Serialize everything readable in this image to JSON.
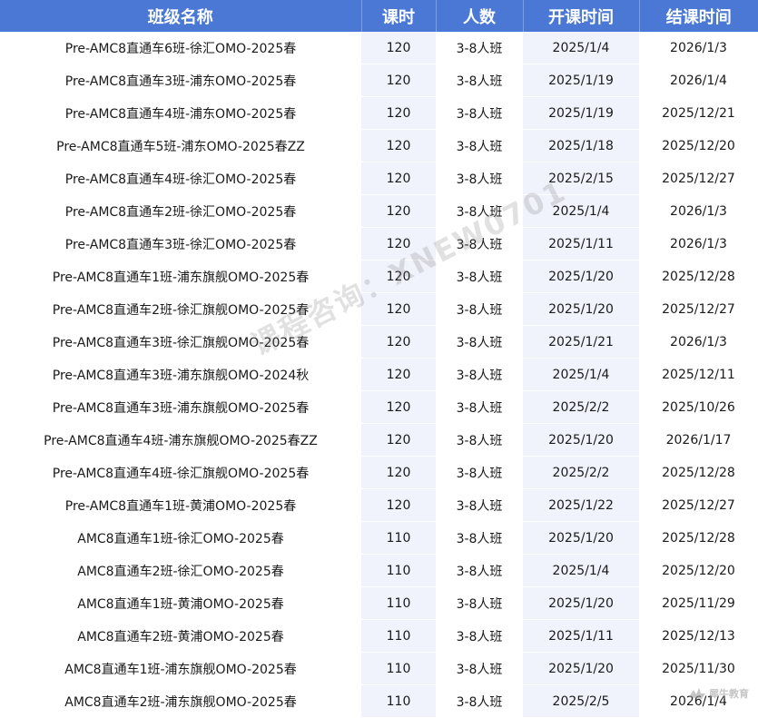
{
  "headers": {
    "name": "班级名称",
    "hours": "课时",
    "size": "人数",
    "start": "开课时间",
    "end": "结课时间"
  },
  "rows": [
    {
      "name": "Pre-AMC8直通车6班-徐汇OMO-2025春",
      "hours": "120",
      "size": "3-8人班",
      "start": "2025/1/4",
      "end": "2026/1/3"
    },
    {
      "name": "Pre-AMC8直通车3班-浦东OMO-2025春",
      "hours": "120",
      "size": "3-8人班",
      "start": "2025/1/19",
      "end": "2026/1/4"
    },
    {
      "name": "Pre-AMC8直通车4班-浦东OMO-2025春",
      "hours": "120",
      "size": "3-8人班",
      "start": "2025/1/19",
      "end": "2025/12/21"
    },
    {
      "name": "Pre-AMC8直通车5班-浦东OMO-2025春ZZ",
      "hours": "120",
      "size": "3-8人班",
      "start": "2025/1/18",
      "end": "2025/12/20"
    },
    {
      "name": "Pre-AMC8直通车4班-徐汇OMO-2025春",
      "hours": "120",
      "size": "3-8人班",
      "start": "2025/2/15",
      "end": "2025/12/27"
    },
    {
      "name": "Pre-AMC8直通车2班-徐汇OMO-2025春",
      "hours": "120",
      "size": "3-8人班",
      "start": "2025/1/4",
      "end": "2026/1/3"
    },
    {
      "name": "Pre-AMC8直通车3班-徐汇OMO-2025春",
      "hours": "120",
      "size": "3-8人班",
      "start": "2025/1/11",
      "end": "2026/1/3"
    },
    {
      "name": "Pre-AMC8直通车1班-浦东旗舰OMO-2025春",
      "hours": "120",
      "size": "3-8人班",
      "start": "2025/1/20",
      "end": "2025/12/28"
    },
    {
      "name": "Pre-AMC8直通车2班-徐汇旗舰OMO-2025春",
      "hours": "120",
      "size": "3-8人班",
      "start": "2025/1/20",
      "end": "2025/12/27"
    },
    {
      "name": "Pre-AMC8直通车3班-徐汇旗舰OMO-2025春",
      "hours": "120",
      "size": "3-8人班",
      "start": "2025/1/21",
      "end": "2026/1/3"
    },
    {
      "name": "Pre-AMC8直通车3班-浦东旗舰OMO-2024秋",
      "hours": "120",
      "size": "3-8人班",
      "start": "2025/1/4",
      "end": "2025/12/11"
    },
    {
      "name": "Pre-AMC8直通车3班-浦东旗舰OMO-2025春",
      "hours": "120",
      "size": "3-8人班",
      "start": "2025/2/2",
      "end": "2025/10/26"
    },
    {
      "name": "Pre-AMC8直通车4班-浦东旗舰OMO-2025春ZZ",
      "hours": "120",
      "size": "3-8人班",
      "start": "2025/1/20",
      "end": "2026/1/17"
    },
    {
      "name": "Pre-AMC8直通车4班-徐汇旗舰OMO-2025春",
      "hours": "120",
      "size": "3-8人班",
      "start": "2025/2/2",
      "end": "2025/12/28"
    },
    {
      "name": "Pre-AMC8直通车1班-黄浦OMO-2025春",
      "hours": "120",
      "size": "3-8人班",
      "start": "2025/1/22",
      "end": "2025/12/27"
    },
    {
      "name": "AMC8直通车1班-徐汇OMO-2025春",
      "hours": "110",
      "size": "3-8人班",
      "start": "2025/1/20",
      "end": "2025/12/28"
    },
    {
      "name": "AMC8直通车2班-徐汇OMO-2025春",
      "hours": "110",
      "size": "3-8人班",
      "start": "2025/1/4",
      "end": "2025/12/20"
    },
    {
      "name": "AMC8直通车1班-黄浦OMO-2025春",
      "hours": "110",
      "size": "3-8人班",
      "start": "2025/1/20",
      "end": "2025/11/29"
    },
    {
      "name": "AMC8直通车2班-黄浦OMO-2025春",
      "hours": "110",
      "size": "3-8人班",
      "start": "2025/1/11",
      "end": "2025/12/13"
    },
    {
      "name": "AMC8直通车1班-浦东旗舰OMO-2025春",
      "hours": "110",
      "size": "3-8人班",
      "start": "2025/1/20",
      "end": "2025/11/30"
    },
    {
      "name": "AMC8直通车2班-浦东旗舰OMO-2025春",
      "hours": "110",
      "size": "3-8人班",
      "start": "2025/2/5",
      "end": "2026/1/4"
    }
  ],
  "watermark": "课程咨询：XNEW0701",
  "logo_text": "犀牛教育"
}
